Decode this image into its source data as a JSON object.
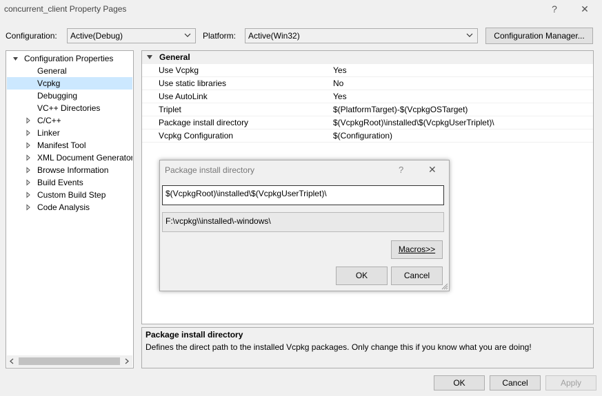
{
  "window": {
    "title": "concurrent_client Property Pages",
    "help": "?",
    "close": "✕"
  },
  "toolbar": {
    "configuration_label": "Configuration:",
    "configuration_value": "Active(Debug)",
    "platform_label": "Platform:",
    "platform_value": "Active(Win32)",
    "config_manager_label": "Configuration Manager..."
  },
  "tree": {
    "items": [
      {
        "label": "Configuration Properties",
        "expand": "down"
      },
      {
        "label": "General"
      },
      {
        "label": "Vcpkg",
        "selected": true
      },
      {
        "label": "Debugging"
      },
      {
        "label": "VC++ Directories"
      },
      {
        "label": "C/C++",
        "expand": "right"
      },
      {
        "label": "Linker",
        "expand": "right"
      },
      {
        "label": "Manifest Tool",
        "expand": "right"
      },
      {
        "label": "XML Document Generator",
        "expand": "right"
      },
      {
        "label": "Browse Information",
        "expand": "right"
      },
      {
        "label": "Build Events",
        "expand": "right"
      },
      {
        "label": "Custom Build Step",
        "expand": "right"
      },
      {
        "label": "Code Analysis",
        "expand": "right"
      }
    ]
  },
  "grid": {
    "section": "General",
    "rows": [
      {
        "name": "Use Vcpkg",
        "value": "Yes"
      },
      {
        "name": "Use static libraries",
        "value": "No"
      },
      {
        "name": "Use AutoLink",
        "value": "Yes"
      },
      {
        "name": "Triplet",
        "value": "$(PlatformTarget)-$(VcpkgOSTarget)"
      },
      {
        "name": "Package install directory",
        "value": "$(VcpkgRoot)\\installed\\$(VcpkgUserTriplet)\\"
      },
      {
        "name": "Vcpkg Configuration",
        "value": "$(Configuration)"
      }
    ]
  },
  "dialog": {
    "title": "Package install directory",
    "help": "?",
    "close": "✕",
    "input_value": "$(VcpkgRoot)\\installed\\$(VcpkgUserTriplet)\\",
    "evaluated_value": "F:\\vcpkg\\\\installed\\-windows\\",
    "macros_label": "Macros>>",
    "ok_label": "OK",
    "cancel_label": "Cancel"
  },
  "description": {
    "title": "Package install directory",
    "text": "Defines the direct path to the installed Vcpkg packages. Only change this if you know what you are doing!"
  },
  "footer": {
    "ok_label": "OK",
    "cancel_label": "Cancel",
    "apply_label": "Apply"
  },
  "colors": {
    "selection": "#cce8ff",
    "background": "#f0f0f0",
    "disabled_text": "#a0a0a0"
  }
}
